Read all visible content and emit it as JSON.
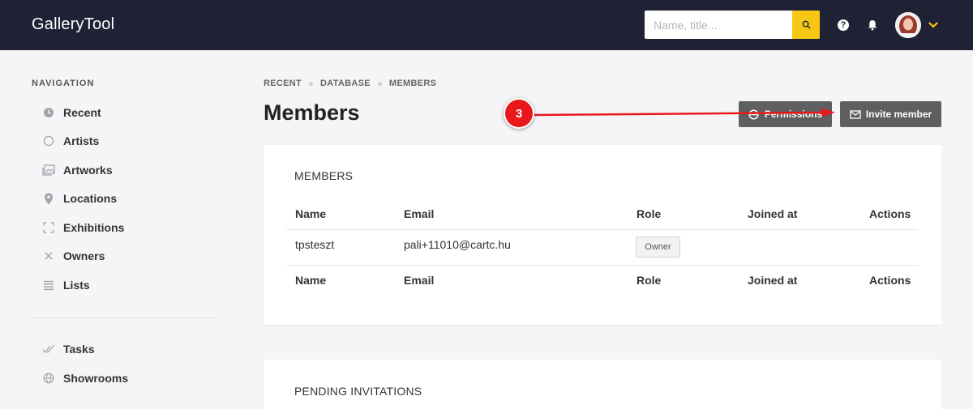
{
  "app": {
    "title": "GalleryTool"
  },
  "search": {
    "placeholder": "Name, title..."
  },
  "header": {
    "help_icon": "help-icon",
    "help_glyph": "?",
    "notifications_icon": "bell-icon",
    "user_menu_icon": "chevron-down-icon"
  },
  "colors": {
    "topbar": "#1f2235",
    "accent": "#f6c813",
    "button": "#5f5f61",
    "annotation": "#e8181b"
  },
  "sidebar": {
    "title": "NAVIGATION",
    "items": [
      {
        "label": "Recent",
        "icon": "clock-icon"
      },
      {
        "label": "Artists",
        "icon": "circle-icon"
      },
      {
        "label": "Artworks",
        "icon": "image-icon"
      },
      {
        "label": "Locations",
        "icon": "location-pin-icon"
      },
      {
        "label": "Exhibitions",
        "icon": "frame-corners-icon"
      },
      {
        "label": "Owners",
        "icon": "cross-icon"
      },
      {
        "label": "Lists",
        "icon": "list-icon"
      }
    ],
    "secondary": [
      {
        "label": "Tasks",
        "icon": "double-check-icon"
      },
      {
        "label": "Showrooms",
        "icon": "globe-icon"
      }
    ]
  },
  "breadcrumb": [
    "RECENT",
    "DATABASE",
    "MEMBERS"
  ],
  "page": {
    "title": "Members",
    "permissions_label": "Permissions",
    "invite_label": "Invite member"
  },
  "members_card": {
    "title": "MEMBERS",
    "columns": [
      "Name",
      "Email",
      "Role",
      "Joined at",
      "Actions"
    ],
    "rows": [
      {
        "name": "tpsteszt",
        "email": "pali+11010@cartc.hu",
        "role": "Owner",
        "joined_at": "",
        "actions": ""
      }
    ]
  },
  "pending_card": {
    "title": "PENDING INVITATIONS"
  },
  "annotation": {
    "step": "3"
  }
}
